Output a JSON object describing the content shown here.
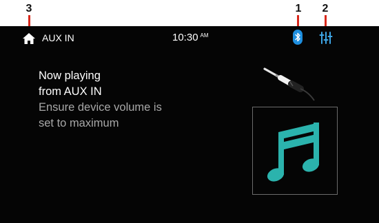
{
  "callouts": {
    "home": "3",
    "bluetooth": "1",
    "equalizer": "2"
  },
  "status_bar": {
    "source": "AUX IN",
    "time": "10:30",
    "ampm": "AM"
  },
  "message": {
    "line1": "Now playing",
    "line2": "from AUX IN",
    "hint1": "Ensure device volume is",
    "hint2": "set to maximum"
  },
  "icons": {
    "home": "home-icon",
    "bluetooth": "bluetooth-icon",
    "equalizer": "equalizer-icon",
    "aux_jack": "aux-jack-icon",
    "music_note": "music-note-icon"
  },
  "colors": {
    "screen_bg": "#050505",
    "bluetooth_accent": "#1e8fe0",
    "equalizer_accent": "#3ea6e6",
    "note_teal": "#2bb3ad",
    "callout_marker": "#d9281b",
    "hint_text": "#a8a8a8"
  }
}
